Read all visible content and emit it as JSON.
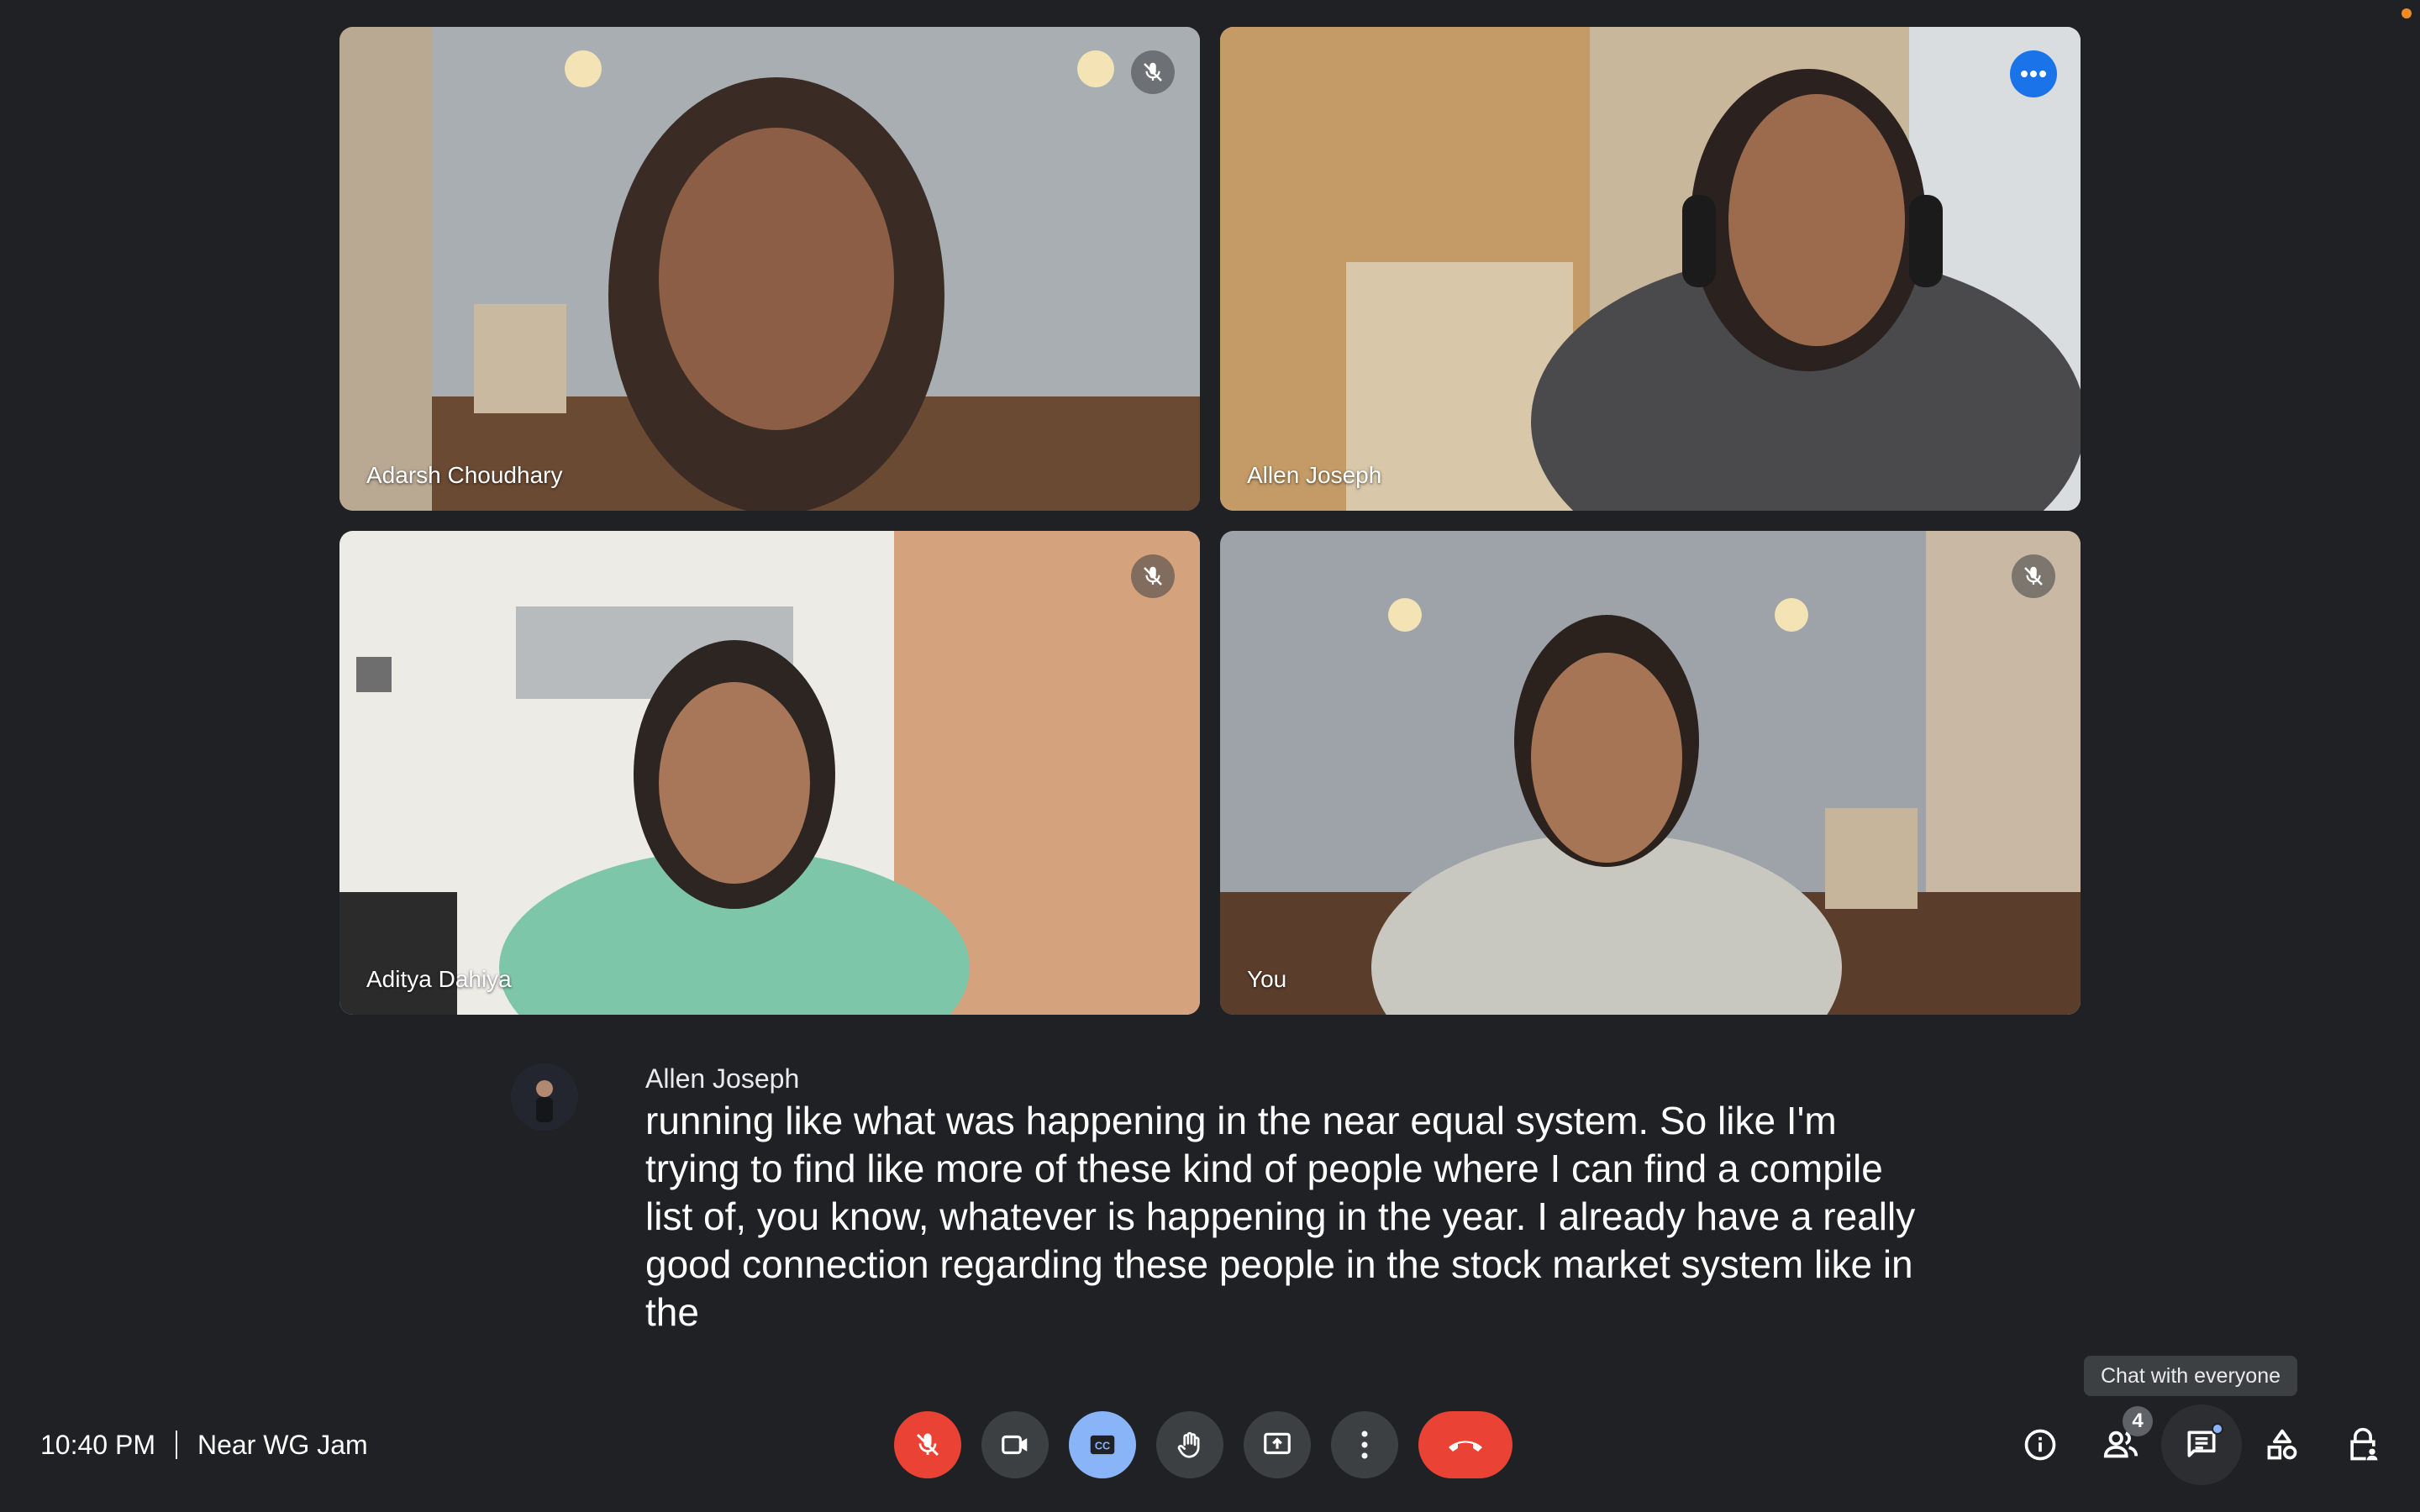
{
  "participants": [
    {
      "name": "Adarsh Choudhary",
      "muted": true,
      "speaking": false
    },
    {
      "name": "Allen Joseph",
      "muted": false,
      "speaking": true
    },
    {
      "name": "Aditya Dahiya",
      "muted": true,
      "speaking": false
    },
    {
      "name": "You",
      "muted": true,
      "speaking": false
    }
  ],
  "caption": {
    "speaker": "Allen Joseph",
    "text": "running like what was happening in the near equal system. So like I'm trying to find like more of these kind of people where I can find a compile list of, you know, whatever is happening in the year. I already have a really good connection regarding these people in the stock market system like in the"
  },
  "meeting": {
    "time": "10:40 PM",
    "title": "Near WG Jam"
  },
  "controls": [
    {
      "icon": "mic-off-icon",
      "label": "Microphone (off)"
    },
    {
      "icon": "video-camera-icon",
      "label": "Camera"
    },
    {
      "icon": "closed-captions-icon",
      "label": "Captions"
    },
    {
      "icon": "raise-hand-icon",
      "label": "Raise hand"
    },
    {
      "icon": "present-screen-icon",
      "label": "Present now"
    },
    {
      "icon": "more-options-icon",
      "label": "More options"
    },
    {
      "icon": "hang-up-icon",
      "label": "Leave call"
    }
  ],
  "right_tools": {
    "people_count": "4",
    "tooltip": "Chat with everyone"
  },
  "colors": {
    "background": "#202124",
    "control_bg": "#3c4043",
    "danger": "#ea4335",
    "accent": "#8ab4f8",
    "active_tile_border": "#8ab4f8"
  }
}
